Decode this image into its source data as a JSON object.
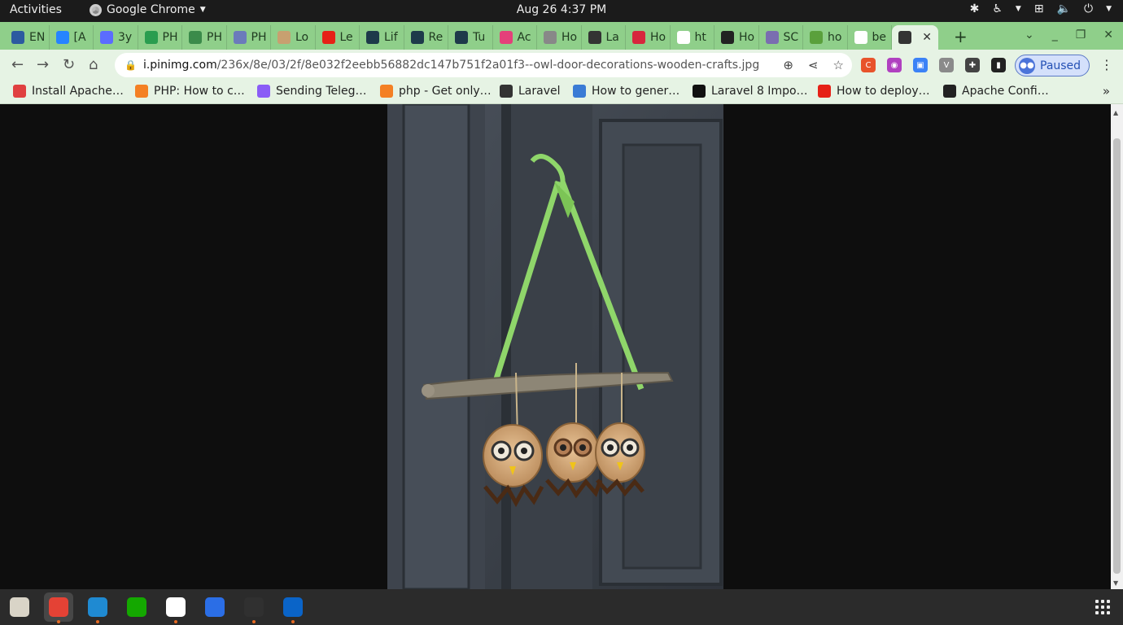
{
  "system": {
    "activities": "Activities",
    "app_name": "Google Chrome",
    "clock": "Aug 26  4:37 PM"
  },
  "tabs": [
    {
      "label": "EN",
      "icon": "text-icon",
      "color": "#2c5aa0"
    },
    {
      "label": "[A",
      "icon": "jira-icon",
      "color": "#2684ff"
    },
    {
      "label": "3y",
      "icon": "code-icon",
      "color": "#5b6cff"
    },
    {
      "label": "PH",
      "icon": "w-icon",
      "color": "#2a9d4f"
    },
    {
      "label": "PH",
      "icon": "infinity-icon",
      "color": "#3b8b4a"
    },
    {
      "label": "PH",
      "icon": "php-icon",
      "color": "#6b7bbb"
    },
    {
      "label": "Lo",
      "icon": "laravel-icon",
      "color": "#c8a070"
    },
    {
      "label": "Le",
      "icon": "youtube-icon",
      "color": "#e62117"
    },
    {
      "label": "Lif",
      "icon": "react-icon",
      "color": "#1e3a4a"
    },
    {
      "label": "Re",
      "icon": "react-icon",
      "color": "#1e3a4a"
    },
    {
      "label": "Tu",
      "icon": "react-icon",
      "color": "#1e3a4a"
    },
    {
      "label": "Ac",
      "icon": "instagram-icon",
      "color": "#e4407a"
    },
    {
      "label": "Ho",
      "icon": "page-icon",
      "color": "#888888"
    },
    {
      "label": "La",
      "icon": "globe-icon",
      "color": "#333333"
    },
    {
      "label": "Ho",
      "icon": "play-icon",
      "color": "#d7263d"
    },
    {
      "label": "ht",
      "icon": "google-icon",
      "color": "#ffffff"
    },
    {
      "label": "Ho",
      "icon": "hex-icon",
      "color": "#222222"
    },
    {
      "label": "SC",
      "icon": "sc-icon",
      "color": "#7a6db0"
    },
    {
      "label": "ho",
      "icon": "leaf-icon",
      "color": "#5aa03c"
    },
    {
      "label": "be",
      "icon": "google-icon",
      "color": "#ffffff"
    },
    {
      "label": "",
      "icon": "globe-icon",
      "color": "#333333",
      "active": true
    }
  ],
  "toolbar": {
    "url_host": "i.pinimg.com",
    "url_path": "/236x/8e/03/2f/8e032f2eebb56882dc147b751f2a01f3--owl-door-decorations-wooden-crafts.jpg",
    "profile_status": "Paused"
  },
  "bookmarks": [
    {
      "label": "Install Apache…",
      "icon": "s-icon",
      "color": "#e04040"
    },
    {
      "label": "PHP: How to c…",
      "icon": "stackoverflow-icon",
      "color": "#f48024"
    },
    {
      "label": "Sending Teleg…",
      "icon": "arrow-icon",
      "color": "#8a5cf6"
    },
    {
      "label": "php - Get only…",
      "icon": "stackoverflow-icon",
      "color": "#f48024"
    },
    {
      "label": "Laravel",
      "icon": "globe-icon",
      "color": "#333333"
    },
    {
      "label": "How to gener…",
      "icon": "telegram-icon",
      "color": "#3a7bd5"
    },
    {
      "label": "Laravel 8 Impo…",
      "icon": "dev-icon",
      "color": "#111111"
    },
    {
      "label": "How to deploy…",
      "icon": "youtube-icon",
      "color": "#e62117"
    },
    {
      "label": "Apache Confi…",
      "icon": "github-icon",
      "color": "#222222"
    }
  ],
  "dock": [
    {
      "name": "files",
      "icon": "files-icon",
      "color": "#d9d4c7",
      "running": false
    },
    {
      "name": "chrome",
      "icon": "chrome-icon",
      "color": "#e44235",
      "running": true,
      "active": true
    },
    {
      "name": "vscode",
      "icon": "vscode-icon",
      "color": "#1f8ad2",
      "running": true
    },
    {
      "name": "upwork",
      "icon": "upwork-icon",
      "color": "#14a800",
      "running": false
    },
    {
      "name": "slack",
      "icon": "slack-icon",
      "color": "#ffffff",
      "running": true
    },
    {
      "name": "remmina",
      "icon": "remmina-icon",
      "color": "#2b6ee6",
      "running": false
    },
    {
      "name": "terminal",
      "icon": "terminal-icon",
      "color": "#303030",
      "running": true
    },
    {
      "name": "outlook",
      "icon": "outlook-icon",
      "color": "#0a64c8",
      "running": true
    }
  ]
}
